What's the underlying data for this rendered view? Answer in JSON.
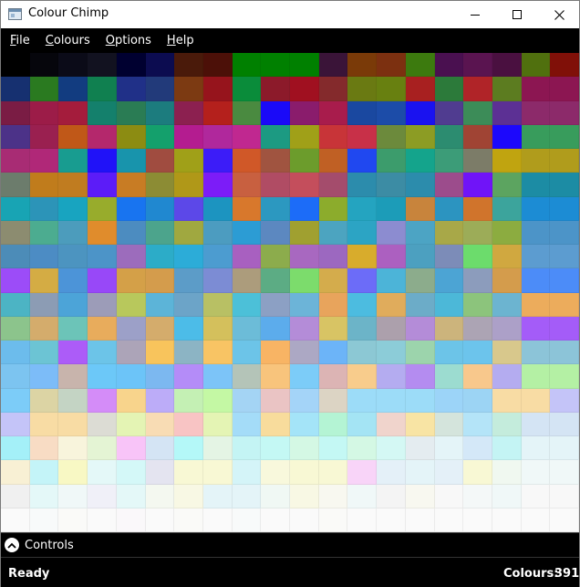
{
  "window": {
    "title": "Colour Chimp"
  },
  "menu": {
    "file": {
      "accel": "F",
      "rest": "ile"
    },
    "colours": {
      "accel": "C",
      "rest": "olours"
    },
    "options": {
      "accel": "O",
      "rest": "ptions"
    },
    "help": {
      "accel": "H",
      "rest": "elp"
    }
  },
  "controls": {
    "label": "Controls"
  },
  "status": {
    "text": "Ready",
    "colours_label": "Colours:",
    "colours_count": "391"
  },
  "grid": {
    "columns": 20,
    "rows": [
      [
        "#000000",
        "#06060c",
        "#0b0b18",
        "#121220",
        "#000030",
        "#0c0c50",
        "#4a1a0a",
        "#4c1008",
        "#008000",
        "#008000",
        "#008000",
        "#3a1438",
        "#7a3a08",
        "#7c3010",
        "#3c7a0e",
        "#4a1050",
        "#5a1450",
        "#4a1040",
        "#50700e",
        "#801008"
      ],
      [
        "#163070",
        "#2a7a20",
        "#123c80",
        "#108050",
        "#203088",
        "#223a7a",
        "#7c3a12",
        "#96141c",
        "#0a8c3a",
        "#8c1a2a",
        "#a01020",
        "#842a2c",
        "#6a7a12",
        "#688010",
        "#a82020",
        "#2c7a3a",
        "#b02428",
        "#5c7c20",
        "#8c1652",
        "#8c1652"
      ],
      [
        "#7a1c44",
        "#9c1c48",
        "#a41c3c",
        "#14806c",
        "#2a7c54",
        "#1c7c7e",
        "#8c2050",
        "#b4201c",
        "#4a8a40",
        "#1a0af8",
        "#8a1c6c",
        "#a81c4c",
        "#1a48a0",
        "#1c4ca8",
        "#1a12f0",
        "#503c90",
        "#3c8c58",
        "#5c3094",
        "#8c2a6a",
        "#8c2a6a"
      ],
      [
        "#4c3288",
        "#9a2050",
        "#c05818",
        "#b4286c",
        "#8c8c12",
        "#14a06c",
        "#b41c90",
        "#b0289c",
        "#c02890",
        "#1c9a82",
        "#a0a018",
        "#c83438",
        "#c83048",
        "#6c8a3c",
        "#8c9c24",
        "#2c8c70",
        "#a04434",
        "#1c08fc",
        "#389c5c",
        "#389c5c"
      ],
      [
        "#a82c74",
        "#b02878",
        "#189c90",
        "#2012f8",
        "#1894ac",
        "#a04c40",
        "#a0a018",
        "#3c1cf8",
        "#d05828",
        "#a05440",
        "#6c9c2c",
        "#c06024",
        "#2048f0",
        "#3c9c6c",
        "#14a48c",
        "#3c9c78",
        "#7c7c68",
        "#c0a410",
        "#b09c1c",
        "#b09c1c"
      ],
      [
        "#6c7c6c",
        "#c07c1c",
        "#c07c20",
        "#5c1cf8",
        "#c87c24",
        "#8c8c34",
        "#b09818",
        "#7c1cf8",
        "#c86040",
        "#b04c64",
        "#c44e5c",
        "#a44c6c",
        "#2c8cac",
        "#3c8ca4",
        "#2c8cac",
        "#9c4c8c",
        "#7014f8",
        "#5ca460",
        "#1c8ca4",
        "#1c8ca4"
      ],
      [
        "#18a4b4",
        "#2c94b8",
        "#18a4c0",
        "#98ac2c",
        "#1874f0",
        "#2088d0",
        "#5c48e8",
        "#1c94c0",
        "#d8782c",
        "#2c98c0",
        "#1c6cf8",
        "#8cac2c",
        "#24a4c0",
        "#1c9cb8",
        "#c8843c",
        "#2c94c0",
        "#d0742c",
        "#3ca49c",
        "#1c8cd4",
        "#1c8cd4"
      ],
      [
        "#8c8c70",
        "#4cac90",
        "#4c9cbc",
        "#e08c2c",
        "#4c8cc0",
        "#4ca48c",
        "#a0a840",
        "#4c9cc0",
        "#2c9cd4",
        "#5c88c0",
        "#a0a030",
        "#4ca4c0",
        "#2ca4c4",
        "#8c8cd0",
        "#4ca4c4",
        "#a8a848",
        "#9cac58",
        "#8cac40",
        "#4c94c8",
        "#4c94c8"
      ],
      [
        "#4c8cb8",
        "#4c8cc4",
        "#4c94c0",
        "#4c94c8",
        "#9c6cbc",
        "#2cacc8",
        "#2cacd8",
        "#4c9cd0",
        "#a860c0",
        "#8cac4c",
        "#a868c0",
        "#9c68c0",
        "#d8ac2c",
        "#ac60c0",
        "#4ca0c0",
        "#7c8cb8",
        "#6cdc6c",
        "#d0a840",
        "#5c9cd0",
        "#5c9cd0"
      ],
      [
        "#9c4cf8",
        "#d4ac44",
        "#4c94d8",
        "#9848f8",
        "#d4a048",
        "#d49c4c",
        "#5c9cc8",
        "#7c8cd4",
        "#ac9c7c",
        "#5cac84",
        "#7cdc6c",
        "#d4ac4c",
        "#6c6cf8",
        "#4cb4d8",
        "#8cac8c",
        "#4ca4d4",
        "#8c9cbc",
        "#d49c4c",
        "#4c8cf8",
        "#4c8cf8"
      ],
      [
        "#4cb4c4",
        "#8c9cb4",
        "#4ca4d8",
        "#9c9cb8",
        "#b8c85c",
        "#5cb4d8",
        "#6ca4c8",
        "#b8c064",
        "#4cc0d8",
        "#8ca0c4",
        "#6cb4d8",
        "#e8a45c",
        "#4cbce0",
        "#e0ac5c",
        "#6cacc8",
        "#4cb8d8",
        "#8cc47c",
        "#6cb4d0",
        "#ecac5c",
        "#ecac5c"
      ],
      [
        "#8cc48c",
        "#d4ac6c",
        "#6cc4b8",
        "#e8ac5c",
        "#9ca0c8",
        "#d4ac6c",
        "#4cbce8",
        "#d4c05c",
        "#6cbcd8",
        "#5cacec",
        "#b48cd8",
        "#d8c464",
        "#6cb4c8",
        "#aca0ac",
        "#b48cd8",
        "#ccb47c",
        "#aca4b4",
        "#aca0c8",
        "#a45cf8",
        "#a45cf8"
      ],
      [
        "#6cbcec",
        "#6cc4d4",
        "#ac5cf8",
        "#6cc4e8",
        "#aca4b8",
        "#f8c45c",
        "#8cb4c4",
        "#f8c464",
        "#6cc4e8",
        "#f8b464",
        "#aca8c4",
        "#6cb4f8",
        "#8cc8d4",
        "#8cccd8",
        "#9cd4ac",
        "#6cc4e8",
        "#6cc4ec",
        "#d8c88c",
        "#8cc4d8",
        "#8cc4d8"
      ],
      [
        "#7cc4f0",
        "#7cbcf8",
        "#c8b4ac",
        "#6cc8f8",
        "#6cc4f8",
        "#7cb8f0",
        "#b48cf8",
        "#7cc4f8",
        "#b4c4b8",
        "#f8c47c",
        "#7cccf8",
        "#dcb4b4",
        "#f8cc8c",
        "#b4acf0",
        "#b48cf0",
        "#9cdcd0",
        "#f8c88c",
        "#b4acf0",
        "#b4f0a4",
        "#b4f0a4"
      ],
      [
        "#7cccf8",
        "#dcd4a4",
        "#c4d4c4",
        "#d48cf8",
        "#f8d48c",
        "#bcacf8",
        "#c4f0b4",
        "#c4f8a4",
        "#a4d4f4",
        "#eac4c4",
        "#a4d4f8",
        "#dcd4c4",
        "#9cdcf8",
        "#9cdcf8",
        "#9cdcf8",
        "#9cd4f8",
        "#9cd4f4",
        "#f8dca4",
        "#f8dca4",
        "#c4c4f8"
      ],
      [
        "#c4c4f8",
        "#f8dca4",
        "#f8dca4",
        "#dcdcd4",
        "#e4f4b4",
        "#f8dcb4",
        "#f8c4c4",
        "#e4f4b4",
        "#a4dcf8",
        "#f8dc9c",
        "#a4e4f8",
        "#b4f4d4",
        "#a4e4f4",
        "#f0d4cc",
        "#f8e4a4",
        "#d4e4dc",
        "#b4e4f8",
        "#c4ecdc",
        "#d4e4f4",
        "#d4e4f4"
      ],
      [
        "#a4f0f8",
        "#f8dcc4",
        "#f8f4dc",
        "#e4f4d4",
        "#f8c4f8",
        "#d4e4f4",
        "#b4f8f8",
        "#e4f4e4",
        "#c4f4f4",
        "#c4f8f4",
        "#d4f8e4",
        "#c4f8f4",
        "#d4f8e4",
        "#d4f8f4",
        "#e4ecf0",
        "#e4f4f8",
        "#d4e8f8",
        "#c4f4f4",
        "#e4f4f8",
        "#e4f4f8"
      ],
      [
        "#f8f0d4",
        "#c4f4f8",
        "#f8f8c4",
        "#e4f8f8",
        "#d4f8f8",
        "#e4e4f0",
        "#f8f8d4",
        "#f8f8d4",
        "#d4f4f8",
        "#f8f8dc",
        "#f8f8d4",
        "#f8f8d4",
        "#f8d4f8",
        "#e4f0f8",
        "#e4f4f8",
        "#e4f0f8",
        "#f8f8d4",
        "#f0f8f0",
        "#f0f8f8",
        "#f0f8f8"
      ],
      [
        "#f0f0f0",
        "#e4f8f8",
        "#f0f8f8",
        "#f0f0f8",
        "#e4f8f8",
        "#f4f8f0",
        "#f8f8e4",
        "#e4f4f8",
        "#e4f4f8",
        "#f0f8f4",
        "#f8f8e4",
        "#f8f8f0",
        "#f0f8f8",
        "#f4f4f4",
        "#f8f8f0",
        "#f8f8f8",
        "#f4f8f8",
        "#f0f8f8",
        "#f8f8f8",
        "#f8f8f8"
      ],
      [
        "#fafafa",
        "#f8fafa",
        "#fafaf8",
        "#fafafa",
        "#faf8fa",
        "#fafafa",
        "#fafaf8",
        "#fafafa",
        "#f8fafa",
        "#fafafa",
        "#fafafa",
        "#fafaf8",
        "#fafafa",
        "#fafafa",
        "#fafafa",
        "#fafafa",
        "#fafafa",
        "#fafafa",
        "#fafafa",
        "#fafafa"
      ]
    ]
  }
}
